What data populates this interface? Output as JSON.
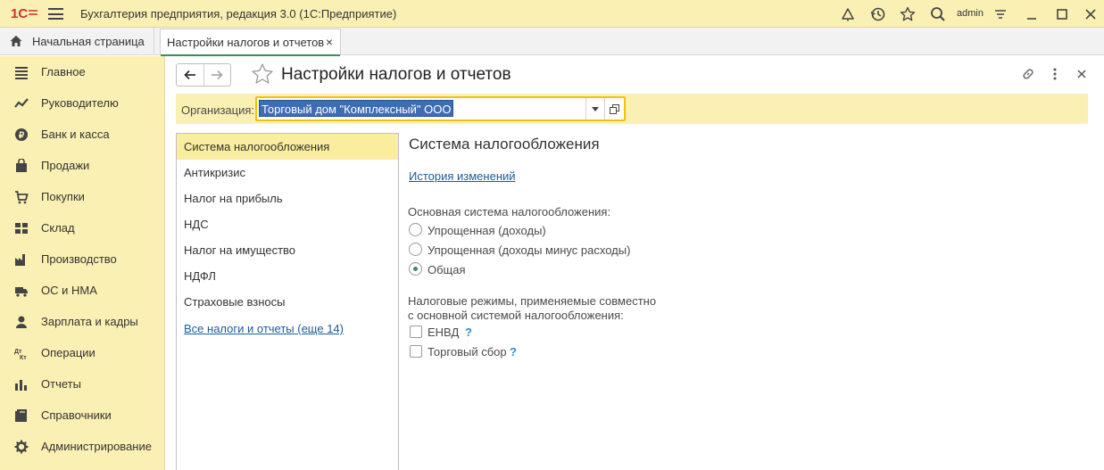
{
  "titlebar": {
    "app_title": "Бухгалтерия предприятия, редакция 3.0  (1С:Предприятие)",
    "user": "admin",
    "icons": [
      "1c-logo-icon",
      "menu-icon",
      "bell-icon",
      "history-icon",
      "star-icon",
      "search-icon",
      "settings-icon",
      "minimize-icon",
      "maximize-icon",
      "close-icon"
    ]
  },
  "tabs": {
    "home_label": "Начальная страница",
    "active_label": "Настройки налогов и отчетов",
    "close_glyph": "×"
  },
  "sidebar": {
    "items": [
      {
        "label": "Главное",
        "icon": "menu-lines-icon"
      },
      {
        "label": "Руководителю",
        "icon": "chart-line-icon"
      },
      {
        "label": "Банк и касса",
        "icon": "coin-icon"
      },
      {
        "label": "Продажи",
        "icon": "cart-icon"
      },
      {
        "label": "Покупки",
        "icon": "basket-icon"
      },
      {
        "label": "Склад",
        "icon": "warehouse-icon"
      },
      {
        "label": "Производство",
        "icon": "factory-icon"
      },
      {
        "label": "ОС и НМА",
        "icon": "truck-icon"
      },
      {
        "label": "Зарплата и кадры",
        "icon": "person-icon"
      },
      {
        "label": "Операции",
        "icon": "dt-kt-icon"
      },
      {
        "label": "Отчеты",
        "icon": "bar-chart-icon"
      },
      {
        "label": "Справочники",
        "icon": "book-icon"
      },
      {
        "label": "Администрирование",
        "icon": "gear-icon"
      }
    ]
  },
  "page": {
    "title": "Настройки налогов и отчетов",
    "org_label": "Организация:",
    "org_value": "Торговый дом \"Комплексный\" ООО"
  },
  "sections": {
    "items": [
      "Система налогообложения",
      "Антикризис",
      "Налог на прибыль",
      "НДС",
      "Налог на имущество",
      "НДФЛ",
      "Страховые взносы"
    ],
    "active_index": 0,
    "all_link": "Все налоги и отчеты (еще 14)"
  },
  "tax_system": {
    "title": "Система налогообложения",
    "history_link": "История изменений",
    "main_label": "Основная система налогообложения:",
    "options": [
      "Упрощенная (доходы)",
      "Упрощенная (доходы минус расходы)",
      "Общая"
    ],
    "selected": "Общая",
    "regimes_label_line1": "Налоговые режимы, применяемые совместно",
    "regimes_label_line2": "с основной системой налогообложения:",
    "checkboxes": [
      {
        "label": "ЕНВД",
        "checked": false
      },
      {
        "label": "Торговый сбор",
        "checked": false
      }
    ],
    "help_glyph": "?"
  },
  "colors": {
    "accent_yellow": "#fbf0b4",
    "selection_blue": "#3c6eb4",
    "link_blue": "#1b5c9b",
    "active_green": "#3a8e57",
    "focus_border": "#f0c20f"
  }
}
